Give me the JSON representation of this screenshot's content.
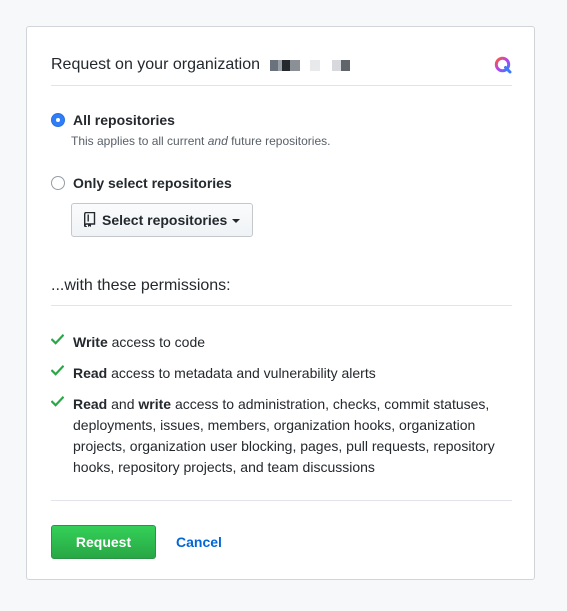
{
  "dialog": {
    "title": "Request on your organization",
    "org_name_redacted": true
  },
  "repo_access": {
    "all": {
      "label": "All repositories",
      "note_before": "This applies to all current ",
      "note_emphasis": "and",
      "note_after": " future repositories.",
      "selected": true
    },
    "select": {
      "label": "Only select repositories",
      "selected": false,
      "button_label": "Select repositories"
    }
  },
  "permissions": {
    "heading": "...with these permissions:",
    "items": [
      {
        "parts": [
          {
            "text": "Write",
            "bold": true
          },
          {
            "text": " access to code",
            "bold": false
          }
        ]
      },
      {
        "parts": [
          {
            "text": "Read",
            "bold": true
          },
          {
            "text": " access to metadata and vulnerability alerts",
            "bold": false
          }
        ]
      },
      {
        "parts": [
          {
            "text": "Read",
            "bold": true
          },
          {
            "text": " and ",
            "bold": false
          },
          {
            "text": "write",
            "bold": true
          },
          {
            "text": " access to administration, checks, commit statuses, deployments, issues, members, organization hooks, organization projects, organization user blocking, pages, pull requests, repository hooks, repository projects, and team discussions",
            "bold": false
          }
        ]
      }
    ]
  },
  "actions": {
    "request_label": "Request",
    "cancel_label": "Cancel"
  },
  "colors": {
    "radio_checked": "#2f7ef7",
    "check_green": "#28a745",
    "request_green": "#2ea44f",
    "link_blue": "#0366d6"
  },
  "icons": {
    "header_logo": "app-logo-icon",
    "select_button": "repo-icon",
    "permission_check": "check-icon",
    "dropdown": "caret-down-icon"
  }
}
